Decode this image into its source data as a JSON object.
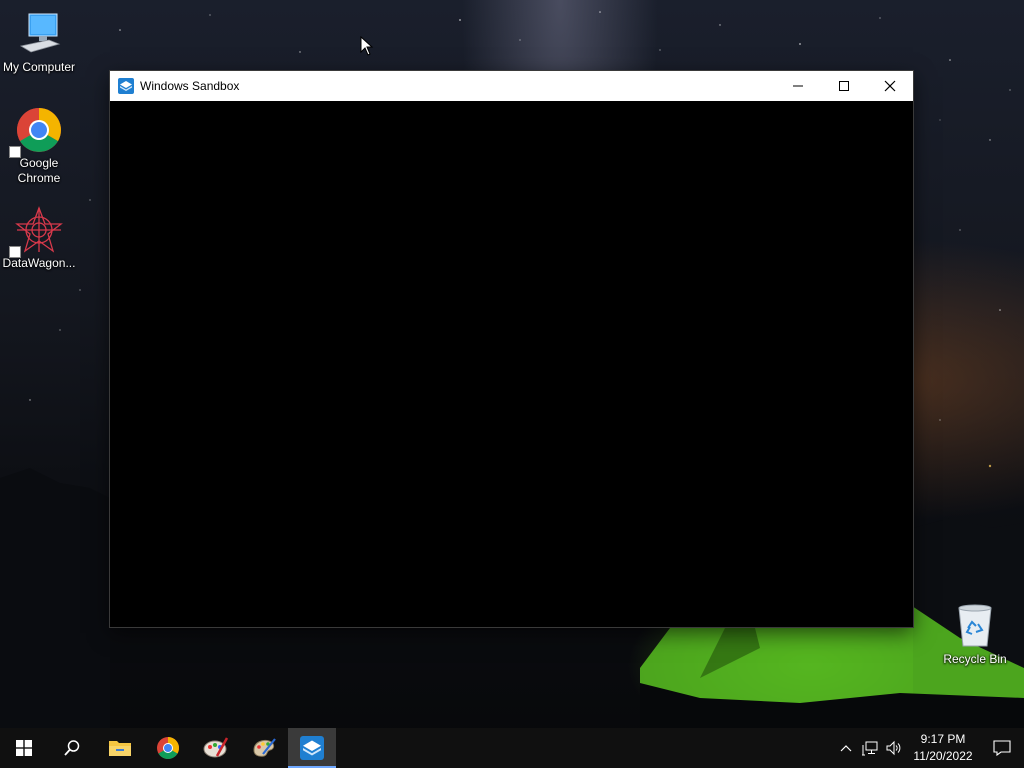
{
  "desktop": {
    "icons": [
      {
        "label": "My Computer",
        "icon": "computer-icon"
      },
      {
        "label": "Google\nChrome",
        "icon": "chrome-icon",
        "shortcut": true
      },
      {
        "label": "DataWagon...",
        "icon": "datawagon-icon",
        "shortcut": true
      },
      {
        "label": "Recycle Bin",
        "icon": "recycle-bin-icon"
      }
    ]
  },
  "window": {
    "title": "Windows Sandbox",
    "icon": "sandbox-icon",
    "controls": [
      "minimize",
      "maximize",
      "close"
    ]
  },
  "taskbar": {
    "items": [
      {
        "name": "start",
        "icon": "windows-logo-icon"
      },
      {
        "name": "search",
        "icon": "search-icon"
      },
      {
        "name": "file-explorer",
        "icon": "folder-icon"
      },
      {
        "name": "chrome",
        "icon": "chrome-icon"
      },
      {
        "name": "paint-app",
        "icon": "paint-icon"
      },
      {
        "name": "paint-palette",
        "icon": "palette-icon"
      },
      {
        "name": "windows-sandbox",
        "icon": "sandbox-icon",
        "active": true
      }
    ],
    "tray": {
      "time": "9:17 PM",
      "date": "11/20/2022"
    }
  },
  "colors": {
    "taskbar": "#101010",
    "active_task": "#3a3a3a",
    "sandbox_blue": "#1f7fd1"
  }
}
